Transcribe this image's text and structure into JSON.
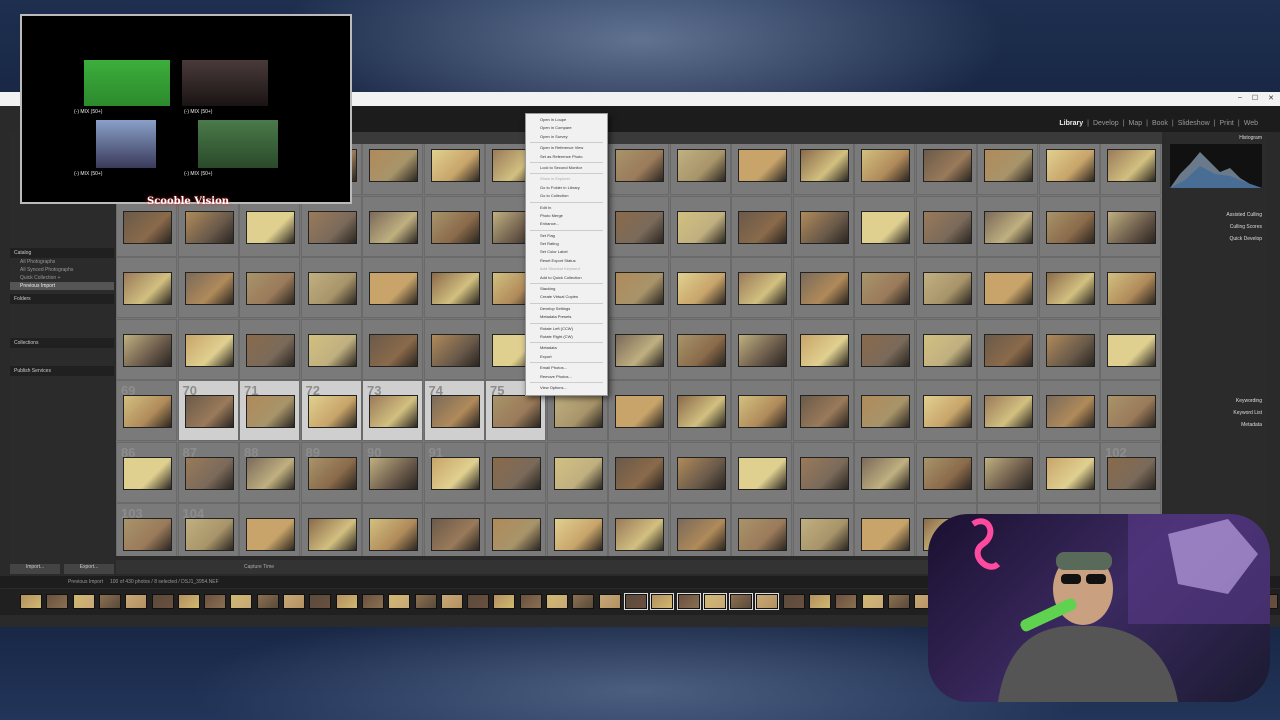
{
  "window": {
    "title": ""
  },
  "modules": {
    "library": "Library",
    "develop": "Develop",
    "map": "Map",
    "book": "Book",
    "slideshow": "Slideshow",
    "print": "Print",
    "web": "Web"
  },
  "left_panel": {
    "catalog": "Catalog",
    "catalog_items": [
      "All Photographs",
      "All Synced Photographs",
      "Quick Collection +",
      "Previous Import"
    ],
    "folders": "Folders",
    "collections": "Collections",
    "publish": "Publish Services"
  },
  "bottom_left": {
    "import": "Import...",
    "export": "Export..."
  },
  "right_panel": {
    "histogram": "Histogram",
    "assisted_culling": "Assisted Culling",
    "culling_scores": "Culling Scores",
    "quick_develop": "Quick Develop",
    "keywording": "Keywording",
    "keyword_list": "Keyword List",
    "metadata": "Metadata"
  },
  "toolbar": {
    "sort": "Capture Time"
  },
  "filmbar": {
    "source": "Previous Import",
    "count": "100 of 430 photos / 8 selected / DSJ1_3954.NEF"
  },
  "obs": {
    "title": "Scooble Vision",
    "labels": [
      "(-) MIX (50+)",
      "(-) MIX (50+)",
      "(-) MIX (50+)",
      "(-) MIX (50+)"
    ]
  },
  "context_menu": {
    "items": [
      "Open in Loupe",
      "Open in Compare",
      "Open in Survey",
      "",
      "Open in Reference View",
      "Set as Reference Photo",
      "",
      "Lock to Second Monitor",
      "",
      "Show in Explorer",
      "Go to Folder in Library",
      "Go to Collection",
      "",
      "Edit In",
      "Photo Merge",
      "Enhance...",
      "",
      "Set Flag",
      "Set Rating",
      "Set Color Label",
      "Reset Export Status",
      "Add Shortcut Keyword",
      "Add to Quick Collection",
      "",
      "Stacking",
      "Create Virtual Copies",
      "",
      "Develop Settings",
      "Metadata Presets",
      "",
      "Rotate Left (CCW)",
      "Rotate Right (CW)",
      "",
      "Metadata",
      "Export",
      "",
      "Email Photos...",
      "Remove Photos...",
      "",
      "View Options..."
    ]
  },
  "grid": {
    "rows": [
      {
        "nums": [
          "",
          "",
          "",
          "",
          "",
          "",
          "",
          "",
          "",
          "",
          "",
          "",
          "",
          "",
          "",
          "",
          ""
        ]
      },
      {
        "nums": [
          "",
          "",
          "",
          "",
          "",
          "",
          "",
          "",
          "",
          "",
          "",
          "",
          "",
          "",
          "",
          "",
          ""
        ]
      },
      {
        "nums": [
          "",
          "",
          "",
          "",
          "",
          "",
          "",
          "",
          "",
          "",
          "",
          "",
          "",
          "",
          "",
          "",
          ""
        ]
      },
      {
        "nums": [
          "",
          "",
          "",
          "",
          "",
          "",
          "",
          "",
          "",
          "",
          "",
          "",
          "",
          "",
          "",
          "",
          ""
        ]
      },
      {
        "nums": [
          "69",
          "70",
          "71",
          "72",
          "73",
          "74",
          "75",
          "",
          "",
          "",
          "",
          "",
          "",
          "",
          "",
          "",
          ""
        ]
      },
      {
        "nums": [
          "86",
          "87",
          "88",
          "89",
          "90",
          "91",
          "",
          "",
          "",
          "",
          "",
          "",
          "",
          "",
          "",
          "",
          "102"
        ]
      },
      {
        "nums": [
          "103",
          "104",
          "",
          "",
          "",
          "",
          "",
          "",
          "",
          "",
          "",
          "",
          "",
          "",
          "",
          "",
          ""
        ]
      }
    ],
    "selected_row": 4,
    "selected_cols": [
      1,
      2,
      3,
      4,
      5,
      6
    ]
  }
}
